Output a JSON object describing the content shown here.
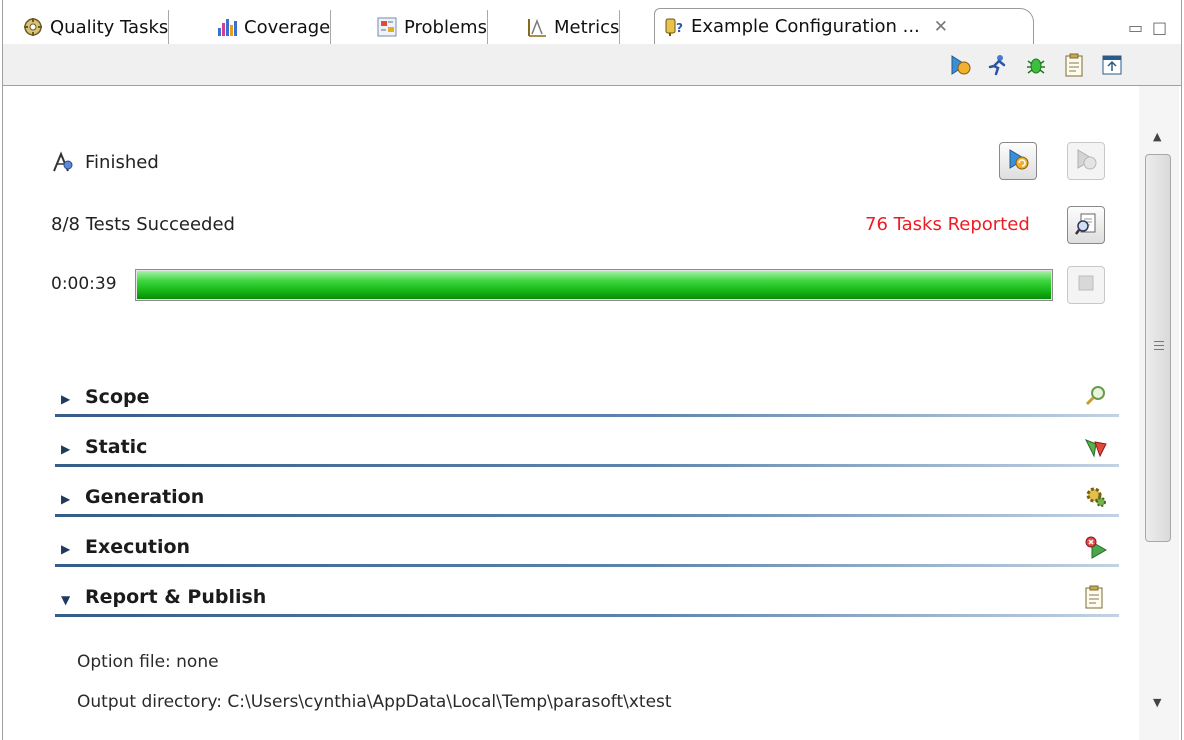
{
  "tabs": [
    {
      "label": "Quality Tasks",
      "icon": "quality-tasks-icon",
      "active": false
    },
    {
      "label": "Coverage",
      "icon": "coverage-chart-icon",
      "active": false
    },
    {
      "label": "Problems",
      "icon": "problems-icon",
      "active": false
    },
    {
      "label": "Metrics",
      "icon": "metrics-icon",
      "active": false
    },
    {
      "label": "Example Configuration ...",
      "icon": "test-config-icon",
      "active": true
    }
  ],
  "toolbar": {
    "buttons": [
      "run-config-icon",
      "run-icon",
      "debug-icon",
      "report-icon",
      "open-view-icon"
    ]
  },
  "status": {
    "state": "Finished",
    "tests": "8/8 Tests Succeeded",
    "tasks": "76 Tasks Reported",
    "elapsed": "0:00:39",
    "progress": 1.0
  },
  "sections": [
    {
      "label": "Scope",
      "expanded": false,
      "icon": "scope-search-icon"
    },
    {
      "label": "Static",
      "expanded": false,
      "icon": "static-analysis-icon"
    },
    {
      "label": "Generation",
      "expanded": false,
      "icon": "generation-gear-icon"
    },
    {
      "label": "Execution",
      "expanded": false,
      "icon": "execution-play-icon"
    },
    {
      "label": "Report & Publish",
      "expanded": true,
      "icon": "report-clipboard-icon"
    }
  ],
  "report_details": {
    "option_file": "Option file: none",
    "output_directory": "Output directory: C:\\Users\\cynthia\\AppData\\Local\\Temp\\parasoft\\xtest"
  },
  "colors": {
    "tasks_red": "#ee1c24",
    "progress_green": "#16b816",
    "section_rule": "#355d8a"
  }
}
